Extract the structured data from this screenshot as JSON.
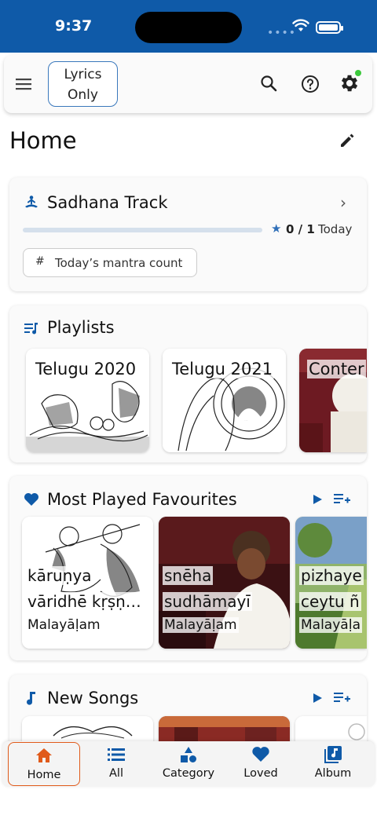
{
  "status": {
    "time": "9:37"
  },
  "toolbar": {
    "lyrics_toggle_line1": "Lyrics",
    "lyrics_toggle_line2": "Only"
  },
  "page": {
    "title": "Home"
  },
  "sadhana": {
    "title": "Sadhana Track",
    "count": "0 / 1",
    "period": "Today",
    "progress": 0,
    "mantra_button": "Today’s mantra count"
  },
  "playlists": {
    "title": "Playlists",
    "items": [
      {
        "label": "Telugu 2020"
      },
      {
        "label": "Telugu 2021"
      },
      {
        "label": "Conter"
      }
    ]
  },
  "favourites": {
    "title": "Most Played Favourites",
    "items": [
      {
        "line1": "kāruṇya",
        "line2": "vāridhē kṛṣṇ…",
        "lang": "Malayāḷam"
      },
      {
        "line1": "snēha",
        "line2": "sudhāmayī",
        "lang": "Malayāḷam"
      },
      {
        "line1": "pizhaye",
        "line2": "ceytu ñ",
        "lang": "Malayāḷa"
      }
    ]
  },
  "new_songs": {
    "title": "New Songs"
  },
  "nav": {
    "home": "Home",
    "all": "All",
    "category": "Category",
    "loved": "Loved",
    "album": "Album"
  },
  "colors": {
    "brand": "#0f5aa8",
    "active_nav": "#e05a1a",
    "notification": "#3cc93c"
  }
}
